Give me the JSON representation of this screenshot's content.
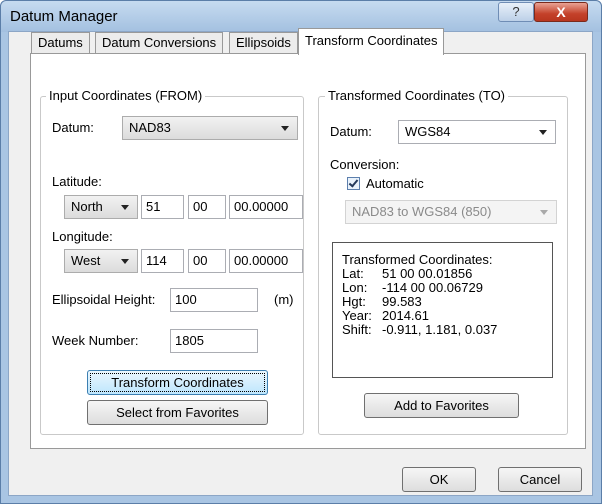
{
  "window": {
    "title": "Datum Manager",
    "help_glyph": "?",
    "close_glyph": "X"
  },
  "tabs": [
    {
      "label": "Datums",
      "active": false
    },
    {
      "label": "Datum Conversions",
      "active": false
    },
    {
      "label": "Ellipsoids",
      "active": false
    },
    {
      "label": "Transform Coordinates",
      "active": true
    }
  ],
  "input": {
    "group_title": "Input Coordinates (FROM)",
    "datum_label": "Datum:",
    "datum_value": "NAD83",
    "latitude_label": "Latitude:",
    "lat_hemisphere": "North",
    "lat_deg": "51",
    "lat_min": "00",
    "lat_sec": "00.00000",
    "longitude_label": "Longitude:",
    "lon_hemisphere": "West",
    "lon_deg": "114",
    "lon_min": "00",
    "lon_sec": "00.00000",
    "height_label": "Ellipsoidal Height:",
    "height_value": "100",
    "height_unit": "(m)",
    "week_label": "Week Number:",
    "week_value": "1805",
    "transform_button": "Transform Coordinates",
    "favorites_button": "Select from Favorites"
  },
  "output": {
    "group_title": "Transformed Coordinates (TO)",
    "datum_label": "Datum:",
    "datum_value": "WGS84",
    "conversion_label": "Conversion:",
    "automatic_label": "Automatic",
    "automatic_checked": true,
    "conversion_value": "NAD83 to WGS84 (850)",
    "results_title": "Transformed Coordinates:",
    "results": [
      {
        "key": "Lat:",
        "value": "51 00 00.01856"
      },
      {
        "key": "Lon:",
        "value": "-114 00 00.06729"
      },
      {
        "key": "Hgt:",
        "value": "99.583"
      },
      {
        "key": "Year:",
        "value": "2014.61"
      },
      {
        "key": "Shift:",
        "value": "-0.911, 1.181, 0.037"
      }
    ],
    "add_favorites_button": "Add to Favorites"
  },
  "footer": {
    "ok_button": "OK",
    "cancel_button": "Cancel"
  },
  "colors": {
    "title_bar": "#a9c5e3",
    "close_button": "#c4412a",
    "focus_button": "#bee6fd",
    "dialog_face": "#f0f0f0"
  }
}
